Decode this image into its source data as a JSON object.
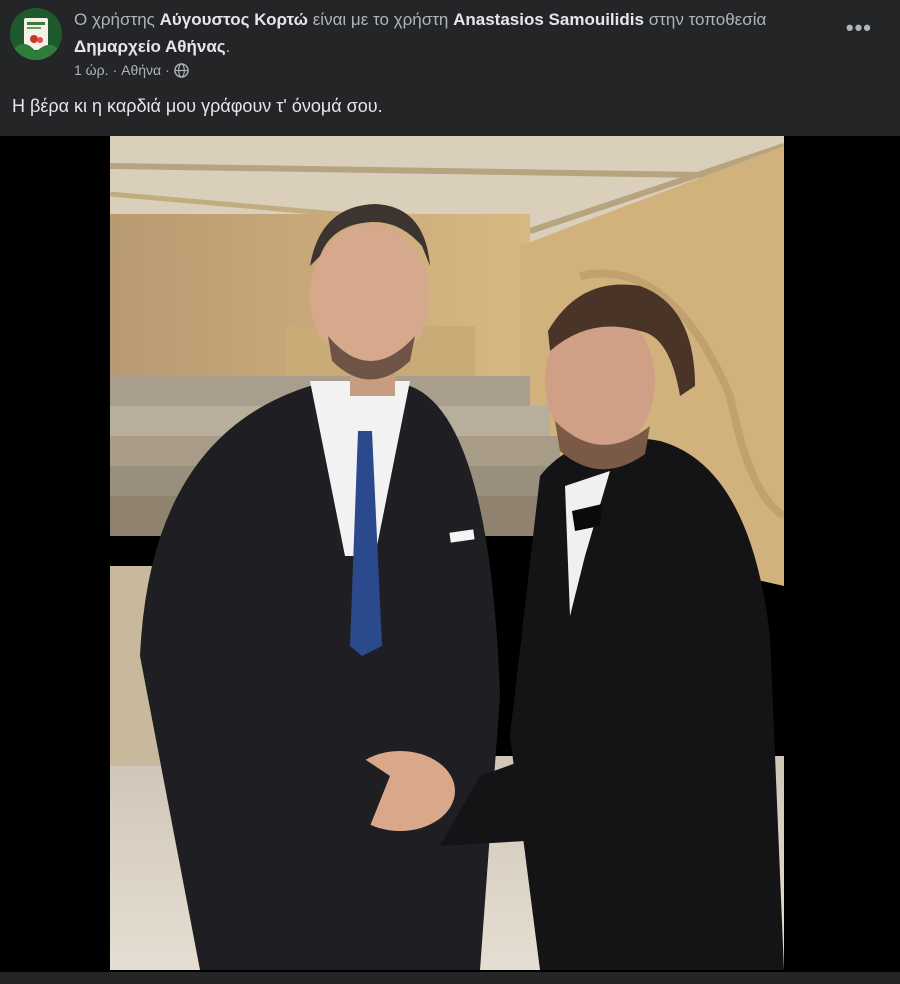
{
  "post": {
    "prefix": "Ο χρήστης",
    "author": "Αύγουστος Κορτώ",
    "with_text": "είναι με το χρήστη",
    "tagged": "Anastasios Samouilidis",
    "location_text": "στην τοποθεσία",
    "location": "Δημαρχείο Αθήνας",
    "period": ".",
    "time": "1 ώρ.",
    "sep1": "·",
    "place": "Αθήνα",
    "sep2": "·",
    "more_label": "•••",
    "caption": "Η βέρα κι η καρδιά μου γράφουν τ' όνομά σου."
  },
  "icons": {
    "avatar": "profile-avatar",
    "privacy": "globe-icon",
    "options": "more-options-icon"
  },
  "colors": {
    "background": "#242526",
    "text_primary": "#e4e6eb",
    "text_secondary": "#b0b3b8",
    "photo_bg": "#000000"
  }
}
